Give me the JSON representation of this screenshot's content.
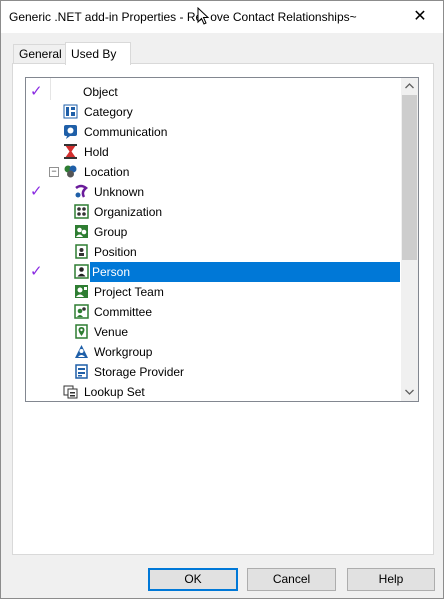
{
  "window": {
    "title": "Generic .NET add-in Properties - Re",
    "title_rest": "ove Contact Relationships~",
    "close_glyph": "✕"
  },
  "tabs": [
    {
      "label": "General",
      "active": false
    },
    {
      "label": "Used By",
      "active": true
    }
  ],
  "tree": {
    "header": "Object",
    "items": [
      {
        "label": "Category",
        "checked": false,
        "icon": "category-icon",
        "level": 1
      },
      {
        "label": "Communication",
        "checked": false,
        "icon": "communication-icon",
        "level": 1
      },
      {
        "label": "Hold",
        "checked": false,
        "icon": "hold-icon",
        "level": 1
      },
      {
        "label": "Location",
        "checked": false,
        "icon": "location-icon",
        "level": 1,
        "expanded": true
      },
      {
        "label": "Unknown",
        "checked": true,
        "icon": "unknown-icon",
        "level": 2
      },
      {
        "label": "Organization",
        "checked": false,
        "icon": "organization-icon",
        "level": 2
      },
      {
        "label": "Group",
        "checked": false,
        "icon": "group-icon",
        "level": 2
      },
      {
        "label": "Position",
        "checked": false,
        "icon": "position-icon",
        "level": 2
      },
      {
        "label": "Person",
        "checked": true,
        "icon": "person-icon",
        "level": 2,
        "selected": true
      },
      {
        "label": "Project Team",
        "checked": false,
        "icon": "project-team-icon",
        "level": 2
      },
      {
        "label": "Committee",
        "checked": false,
        "icon": "committee-icon",
        "level": 2
      },
      {
        "label": "Venue",
        "checked": false,
        "icon": "venue-icon",
        "level": 2
      },
      {
        "label": "Workgroup",
        "checked": false,
        "icon": "workgroup-icon",
        "level": 2
      },
      {
        "label": "Storage Provider",
        "checked": false,
        "icon": "storage-provider-icon",
        "level": 2
      },
      {
        "label": "Lookup Set",
        "checked": false,
        "icon": "lookup-set-icon",
        "level": 1
      }
    ],
    "check_glyph": "✓",
    "header_checked": true
  },
  "buttons": {
    "ok": "OK",
    "cancel": "Cancel",
    "help": "Help"
  },
  "colors": {
    "selection": "#0078d7",
    "check": "#8a2be2",
    "icon_green": "#2e7d32"
  }
}
